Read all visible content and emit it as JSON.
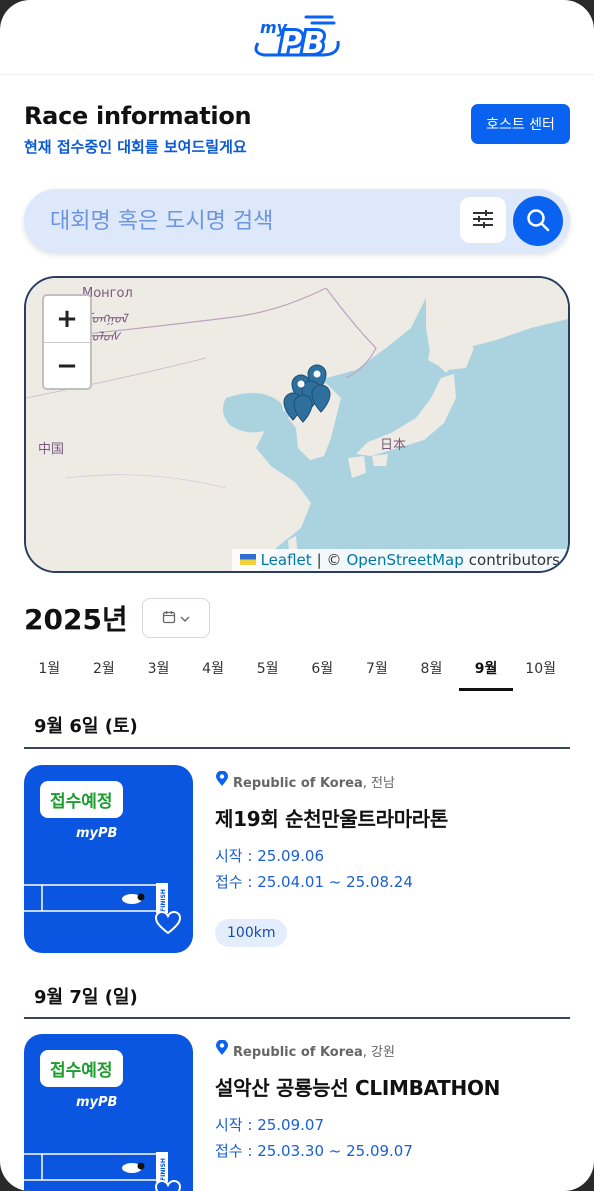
{
  "header": {
    "logo_text": "myPB"
  },
  "page": {
    "title": "Race information",
    "subtitle": "현재 접수중인 대회를 보여드릴게요",
    "host_button": "호스트 센터"
  },
  "search": {
    "placeholder": "대회명 혹은 도시명 검색"
  },
  "map": {
    "zoom_in": "+",
    "zoom_out": "−",
    "labels": {
      "mongolia_cyrillic": "Монгол",
      "mongolia_script": "ᠮᠣᠩᠭᠣᠯ",
      "mongolia_script2": "ᠤᠯᠤᠰ",
      "china": "中国",
      "japan": "日本"
    },
    "attribution": {
      "leaflet": "Leaflet",
      "separator": "| ©",
      "osm": "OpenStreetMap",
      "contributors": "contributors"
    },
    "marker_count": 6
  },
  "calendar": {
    "year": "2025년",
    "months": [
      "1월",
      "2월",
      "3월",
      "4월",
      "5월",
      "6월",
      "7월",
      "8월",
      "9월",
      "10월"
    ],
    "active_month": "9월"
  },
  "races": [
    {
      "date_heading": "9월 6일 (토)",
      "status": "접수예정",
      "country": "Republic of Korea",
      "region": ", 전남",
      "name": "제19회 순천만울트라마라톤",
      "start": "시작 : 25.09.06",
      "registration": "접수 : 25.04.01 ~ 25.08.24",
      "distance": "100km"
    },
    {
      "date_heading": "9월 7일 (일)",
      "status": "접수예정",
      "country": "Republic of Korea",
      "region": ", 강원",
      "name": "설악산 공룡능선 CLIMBATHON",
      "start": "시작 : 25.09.07",
      "registration": "접수 : 25.03.30 ~ 25.09.07"
    }
  ],
  "thumb_text": {
    "logo": "myPB",
    "finish": "FINISH"
  },
  "colors": {
    "brand_blue": "#0a62f0",
    "status_green": "#1c9d2e",
    "link_blue": "#1a5fd4"
  }
}
